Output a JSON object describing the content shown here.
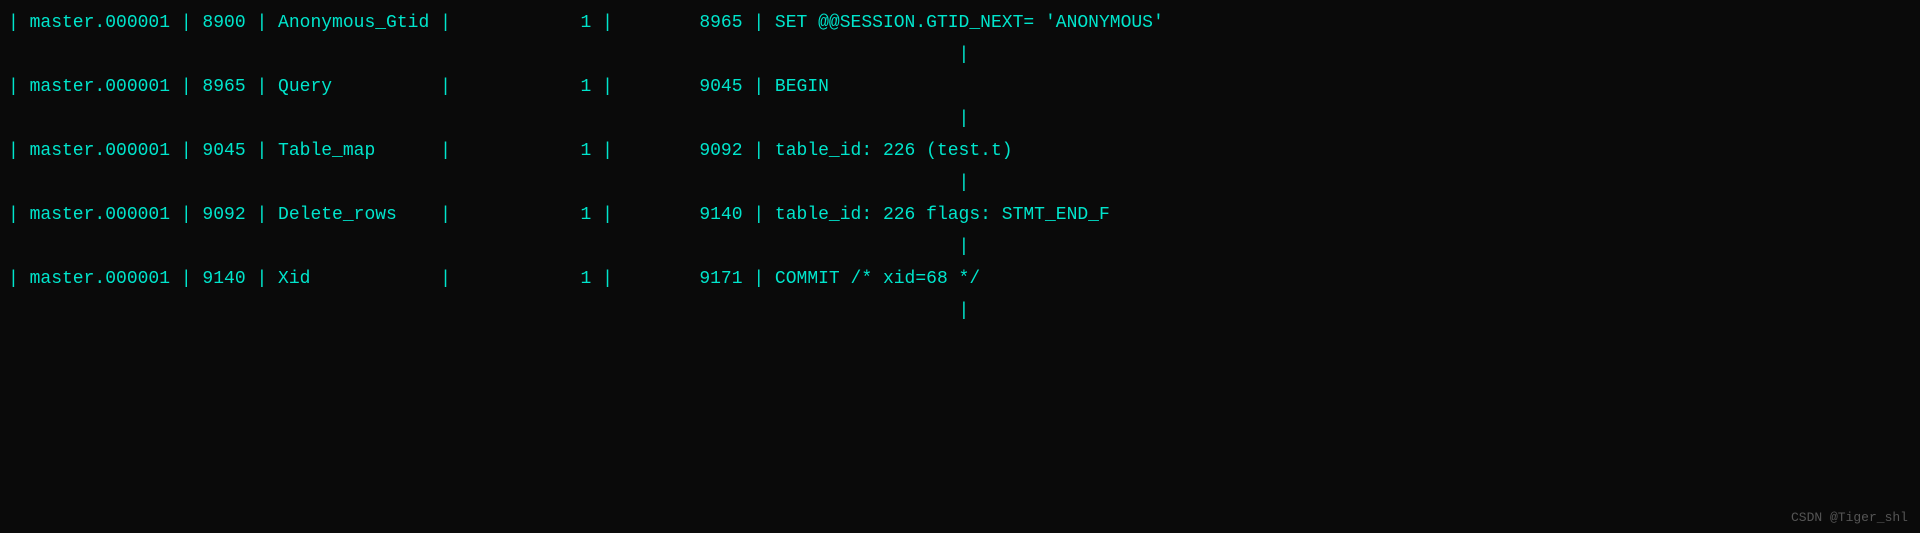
{
  "terminal": {
    "background": "#0a0a0a",
    "text_color": "#00e5cc",
    "rows": [
      {
        "type": "data",
        "log": "| master.000001 | 8900 | Anonymous_Gtid |            1 |        8965 | SET @@SESSION.GTID_NEXT= 'ANONYMOUS'"
      },
      {
        "type": "connector",
        "text": "                                                                                        |"
      },
      {
        "type": "data",
        "log": "| master.000001 | 8965 | Query          |            1 |        9045 | BEGIN"
      },
      {
        "type": "connector",
        "text": "                                                                                        |"
      },
      {
        "type": "data",
        "log": "| master.000001 | 9045 | Table_map      |            1 |        9092 | table_id: 226 (test.t)"
      },
      {
        "type": "connector",
        "text": "                                                                                        |"
      },
      {
        "type": "data",
        "log": "| master.000001 | 9092 | Delete_rows    |            1 |        9140 | table_id: 226 flags: STMT_END_F"
      },
      {
        "type": "connector",
        "text": "                                                                                        |"
      },
      {
        "type": "data",
        "log": "| master.000001 | 9140 | Xid            |            1 |        9171 | COMMIT /* xid=68 */"
      },
      {
        "type": "connector",
        "text": "                                                                                        |"
      }
    ],
    "watermark": "CSDN @Tiger_shl"
  }
}
